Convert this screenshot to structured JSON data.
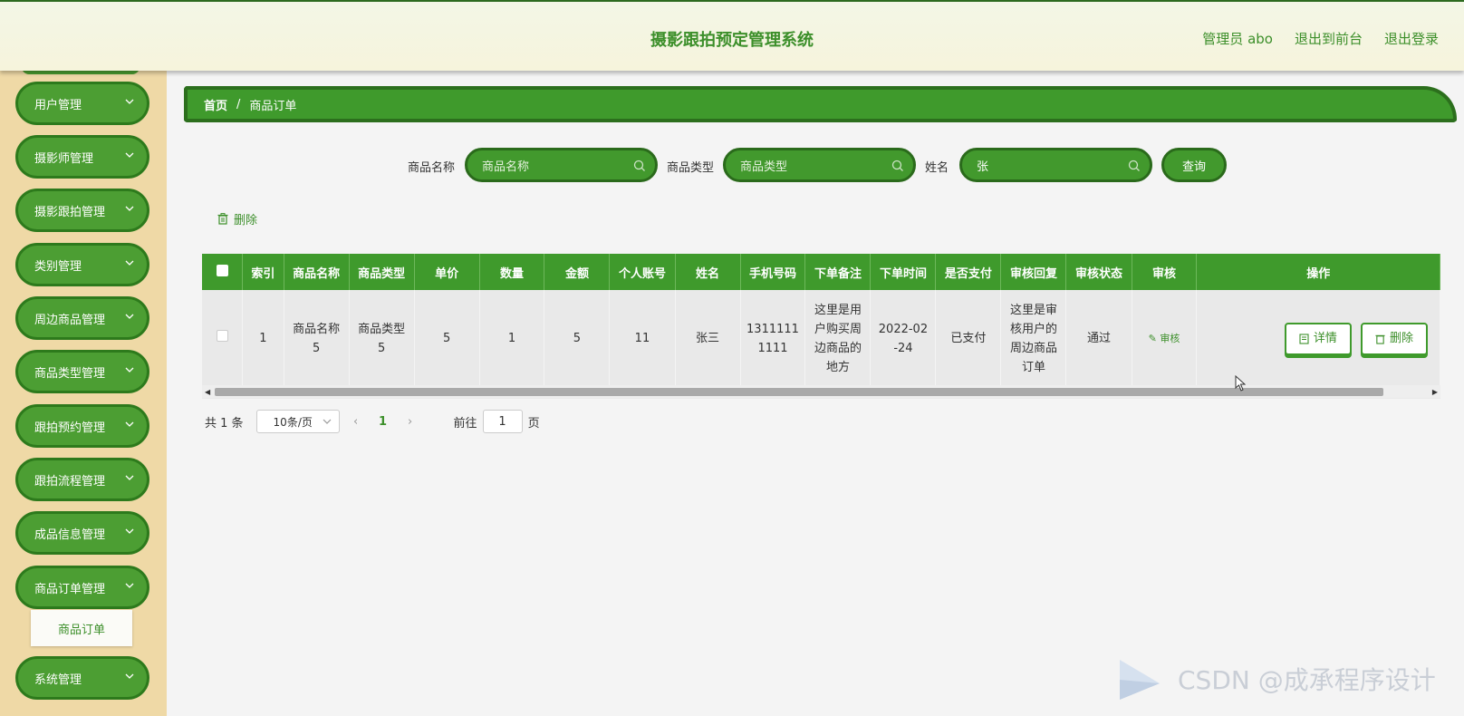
{
  "header": {
    "title": "摄影跟拍预定管理系统",
    "admin": "管理员 abo",
    "to_front": "退出到前台",
    "logout": "退出登录"
  },
  "sidebar": {
    "items": [
      {
        "label": "用户管理"
      },
      {
        "label": "摄影师管理"
      },
      {
        "label": "摄影跟拍管理"
      },
      {
        "label": "类别管理"
      },
      {
        "label": "周边商品管理"
      },
      {
        "label": "商品类型管理"
      },
      {
        "label": "跟拍预约管理"
      },
      {
        "label": "跟拍流程管理"
      },
      {
        "label": "成品信息管理"
      },
      {
        "label": "商品订单管理"
      },
      {
        "label": "系统管理"
      }
    ],
    "submenu": "商品订单"
  },
  "breadcrumb": {
    "home": "首页",
    "sep": "/",
    "current": "商品订单"
  },
  "search": {
    "name_label": "商品名称",
    "name_placeholder": "商品名称",
    "type_label": "商品类型",
    "type_placeholder": "商品类型",
    "person_label": "姓名",
    "person_value": "张",
    "query_label": "查询"
  },
  "toolbar": {
    "delete_label": "删除"
  },
  "table": {
    "columns": [
      "索引",
      "商品名称",
      "商品类型",
      "单价",
      "数量",
      "金额",
      "个人账号",
      "姓名",
      "手机号码",
      "下单备注",
      "下单时间",
      "是否支付",
      "审核回复",
      "审核状态",
      "审核",
      "操作"
    ],
    "rows": [
      {
        "index": "1",
        "name": "商品名称5",
        "type": "商品类型5",
        "price": "5",
        "qty": "1",
        "amount": "5",
        "account": "11",
        "person": "张三",
        "phone": "13111111111",
        "remark": "这里是用户购买周边商品的地方",
        "time": "2022-02-24",
        "paid": "已支付",
        "reply": "这里是审核用户的周边商品订单",
        "status": "通过",
        "audit": "审核",
        "detail": "详情",
        "delete": "删除"
      }
    ]
  },
  "pager": {
    "total": "共 1 条",
    "page_size": "10条/页",
    "current_page": "1",
    "goto_prefix": "前往",
    "goto_value": "1",
    "goto_suffix": "页"
  },
  "watermark": "CSDN @成承程序设计",
  "colors": {
    "primary": "#3f9a2c",
    "dark": "#2a6a1b",
    "sidebar_bg": "#efd9a6"
  }
}
